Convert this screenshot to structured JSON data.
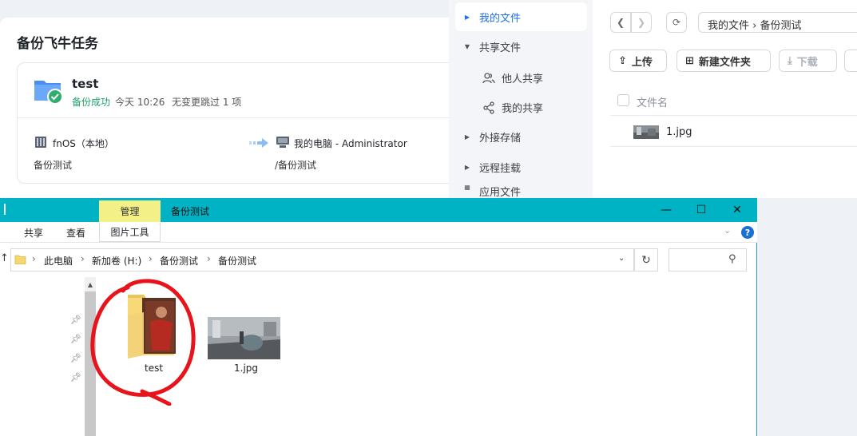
{
  "backup": {
    "title": "备份飞牛任务",
    "task_name": "test",
    "status": "备份成功",
    "time": "今天 10:26",
    "skip": "无变更跳过 1 项",
    "source_name": "fnOS（本地）",
    "source_path": "备份测试",
    "dest_name": "我的电脑 - Administrator",
    "dest_path": "/备份测试"
  },
  "sidebar": {
    "items": [
      {
        "label": "我的文件"
      },
      {
        "label": "共享文件"
      },
      {
        "label": "他人共享"
      },
      {
        "label": "我的共享"
      },
      {
        "label": "外接存储"
      },
      {
        "label": "远程挂载"
      },
      {
        "label": "应用文件"
      }
    ]
  },
  "browser": {
    "path": "我的文件 › 备份测试",
    "upload_label": "上传",
    "newfolder_label": "新建文件夹",
    "download_label": "下载",
    "column_name": "文件名",
    "files": [
      {
        "name": "1.jpg"
      }
    ]
  },
  "explorer": {
    "tab_manage": "管理",
    "window_title": "备份测试",
    "ribbon_share": "共享",
    "ribbon_view": "查看",
    "ribbon_picture_tools": "图片工具",
    "breadcrumbs": [
      "此电脑",
      "新加卷 (H:)",
      "备份测试",
      "备份测试"
    ],
    "items": [
      {
        "label": "test"
      },
      {
        "label": "1.jpg"
      }
    ]
  },
  "colors": {
    "accent": "#1e6fe8",
    "success": "#22a06b",
    "explorer_titlebar": "#00b3c4",
    "manage_tab": "#f3f087",
    "annotation": "#e8141c"
  }
}
